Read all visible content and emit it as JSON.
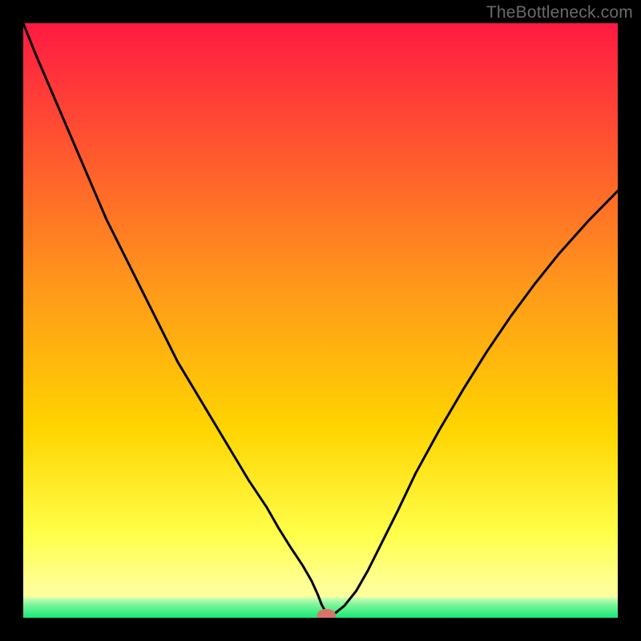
{
  "watermark": "TheBottleneck.com",
  "colors": {
    "frame": "#000000",
    "curve": "#000000",
    "marker_fill": "#d9746b",
    "grad_top": "#ff1a42",
    "grad_mid": "#ffd400",
    "grad_low": "#ffff9a",
    "grad_bottom": "#17e87a"
  },
  "chart_data": {
    "type": "line",
    "title": "",
    "xlabel": "",
    "ylabel": "",
    "xlim": [
      0,
      100
    ],
    "ylim": [
      0,
      100
    ],
    "series": [
      {
        "name": "bottleneck-curve",
        "x": [
          0,
          2,
          5,
          8,
          11,
          14,
          17,
          20,
          23,
          26,
          29,
          32,
          35,
          38,
          41,
          43,
          45,
          47,
          48.5,
          49.5,
          50.2,
          50.8,
          51.5,
          52.5,
          54,
          56,
          58,
          60,
          63,
          66,
          70,
          74,
          78,
          82,
          86,
          90,
          95,
          100
        ],
        "y": [
          100,
          95,
          88,
          81,
          74,
          67,
          61,
          55,
          49,
          43,
          38,
          33,
          28,
          23,
          18.5,
          15,
          11.8,
          8.8,
          6.2,
          4,
          2.2,
          1.1,
          0.5,
          0.8,
          2,
          4.5,
          8,
          12,
          18,
          24.3,
          31.6,
          38.4,
          44.8,
          50.7,
          56.1,
          61.1,
          66.7,
          71.8
        ]
      }
    ],
    "marker": {
      "x": 51.0,
      "y": 0.4,
      "rx": 1.6,
      "ry": 1.1
    },
    "green_band_top_frac": 0.966
  }
}
